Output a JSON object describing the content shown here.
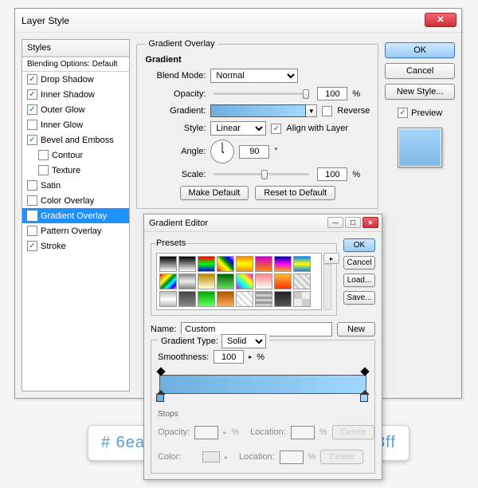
{
  "dialog": {
    "title": "Layer Style"
  },
  "styles_header": "Styles",
  "blending_header": "Blending Options: Default",
  "style_items": {
    "drop_shadow": "Drop Shadow",
    "inner_shadow": "Inner Shadow",
    "outer_glow": "Outer Glow",
    "inner_glow": "Inner Glow",
    "bevel_emboss": "Bevel and Emboss",
    "contour": "Contour",
    "texture": "Texture",
    "satin": "Satin",
    "color_overlay": "Color Overlay",
    "gradient_overlay": "Gradient Overlay",
    "pattern_overlay": "Pattern Overlay",
    "stroke": "Stroke"
  },
  "group": {
    "title": "Gradient Overlay",
    "subtitle": "Gradient",
    "blend_mode_label": "Blend Mode:",
    "blend_mode_value": "Normal",
    "opacity_label": "Opacity:",
    "opacity_value": "100",
    "pct": "%",
    "gradient_label": "Gradient:",
    "reverse_label": "Reverse",
    "style_label": "Style:",
    "style_value": "Linear",
    "align_label": "Align with Layer",
    "angle_label": "Angle:",
    "angle_value": "90",
    "deg": "°",
    "scale_label": "Scale:",
    "scale_value": "100",
    "make_default": "Make Default",
    "reset_default": "Reset to Default"
  },
  "right": {
    "ok": "OK",
    "cancel": "Cancel",
    "new_style": "New Style...",
    "preview": "Preview"
  },
  "ge": {
    "title": "Gradient Editor",
    "presets": "Presets",
    "ok": "OK",
    "cancel": "Cancel",
    "load": "Load...",
    "save": "Save...",
    "name_label": "Name:",
    "name_value": "Custom",
    "new": "New",
    "type_label": "Gradient Type:",
    "type_value": "Solid",
    "smooth_label": "Smoothness:",
    "smooth_value": "100",
    "pct": "%",
    "stops_label": "Stops",
    "opacity_label": "Opacity:",
    "location_label": "Location:",
    "color_label": "Color:",
    "delete": "Delete"
  },
  "callouts": {
    "left_hex": "# 6eafde",
    "right_hex": "# a1d8ff"
  }
}
